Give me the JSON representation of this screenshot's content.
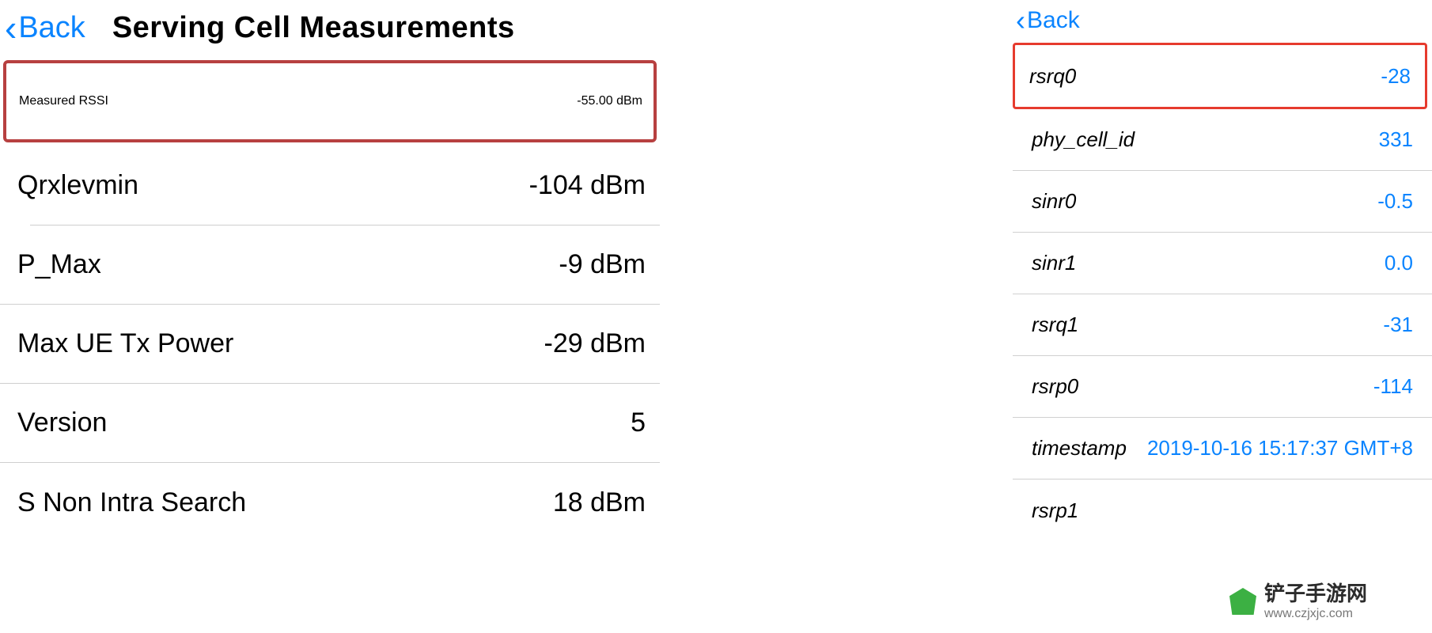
{
  "left": {
    "back_label": "Back",
    "title": "Serving Cell Measurements",
    "rows": [
      {
        "label": "Measured RSSI",
        "value": "-55.00 dBm",
        "highlighted": true
      },
      {
        "label": "Qrxlevmin",
        "value": "-104 dBm"
      },
      {
        "label": "P_Max",
        "value": "-9 dBm"
      },
      {
        "label": "Max UE Tx Power",
        "value": "-29 dBm"
      },
      {
        "label": "Version",
        "value": "5"
      },
      {
        "label": "S Non Intra Search",
        "value": "18 dBm"
      }
    ]
  },
  "right": {
    "back_label": "Back",
    "rows": [
      {
        "label": "rsrq0",
        "value": "-28",
        "highlighted": true
      },
      {
        "label": "phy_cell_id",
        "value": "331"
      },
      {
        "label": "sinr0",
        "value": "-0.5"
      },
      {
        "label": "sinr1",
        "value": "0.0"
      },
      {
        "label": "rsrq1",
        "value": "-31"
      },
      {
        "label": "rsrp0",
        "value": "-114"
      },
      {
        "label": "timestamp",
        "value": "2019-10-16 15:17:37 GMT+8"
      },
      {
        "label": "rsrp1",
        "value": ""
      }
    ]
  },
  "watermark": {
    "line1": "铲子手游网",
    "line2": "www.czjxjc.com"
  }
}
